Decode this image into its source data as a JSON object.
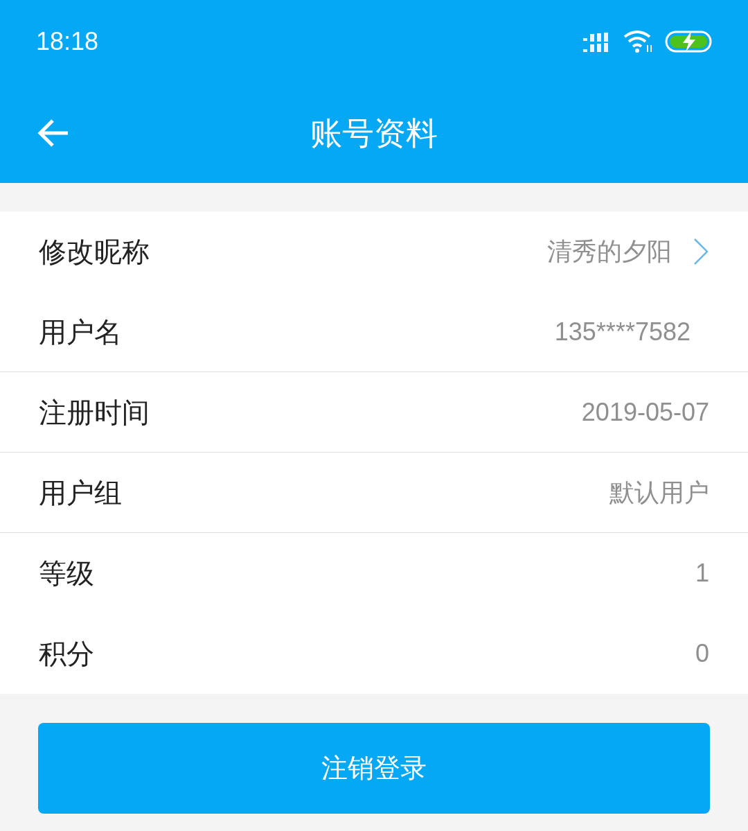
{
  "status_bar": {
    "time": "18:18"
  },
  "header": {
    "title": "账号资料"
  },
  "rows": [
    {
      "label": "修改昵称",
      "value": "清秀的夕阳",
      "kind": "link",
      "divider": false
    },
    {
      "label": "用户名",
      "value": "135****7582",
      "kind": "inset",
      "divider": true
    },
    {
      "label": "注册时间",
      "value": "2019-05-07",
      "kind": "plain",
      "divider": true
    },
    {
      "label": "用户组",
      "value": "默认用户",
      "kind": "plain",
      "divider": true
    },
    {
      "label": "等级",
      "value": "1",
      "kind": "plain",
      "divider": false
    },
    {
      "label": "积分",
      "value": "0",
      "kind": "plain",
      "divider": false
    }
  ],
  "button": {
    "label": "注销登录"
  }
}
